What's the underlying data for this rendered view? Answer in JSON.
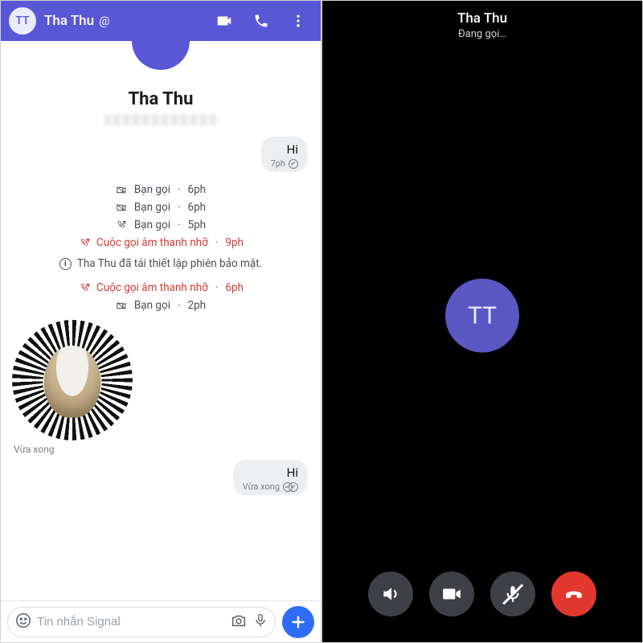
{
  "colors": {
    "accent": "#5a57d6",
    "send": "#2f6df6",
    "endCall": "#e2382d",
    "missed": "#d43a34"
  },
  "chat": {
    "header": {
      "initials": "TT",
      "name": "Tha Thu",
      "at": "@"
    },
    "contact": {
      "name": "Tha Thu"
    },
    "messages": {
      "m1": {
        "text": "Hi",
        "time": "7ph"
      },
      "m2": {
        "text": "Hi",
        "time": "Vừa xong"
      }
    },
    "calls": [
      {
        "type": "video",
        "text": "Bạn gọi",
        "time": "6ph"
      },
      {
        "type": "video",
        "text": "Bạn gọi",
        "time": "6ph"
      },
      {
        "type": "out",
        "text": "Bạn gọi",
        "time": "5ph"
      },
      {
        "type": "missed",
        "text": "Cuộc gọi âm thanh nhỡ",
        "time": "9ph"
      }
    ],
    "security_info": "Tha Thu đã tái thiết lập phiên bảo mật.",
    "calls2": [
      {
        "type": "missed",
        "text": "Cuộc gọi âm thanh nhỡ",
        "time": "6ph"
      },
      {
        "type": "video",
        "text": "Bạn gọi",
        "time": "2ph"
      }
    ],
    "sticker_time": "Vừa xong",
    "input_placeholder": "Tin nhắn Signal"
  },
  "call": {
    "name": "Tha Thu",
    "status": "Đang gọi…",
    "initials": "TT"
  }
}
